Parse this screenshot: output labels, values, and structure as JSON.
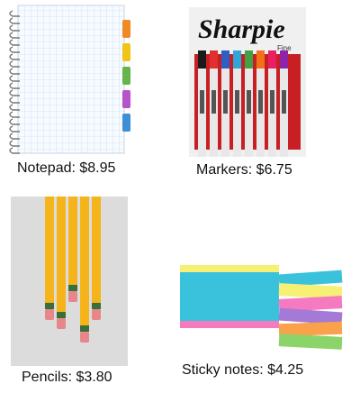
{
  "products": [
    {
      "name": "Notepad",
      "price": "$8.95",
      "caption": "Notepad: $8.95"
    },
    {
      "name": "Markers",
      "price": "$6.75",
      "caption": "Markers: $6.75",
      "brand_text": "Sharpie",
      "box_text": "Fine"
    },
    {
      "name": "Pencils",
      "price": "$3.80",
      "caption": "Pencils: $3.80"
    },
    {
      "name": "Sticky notes",
      "price": "$4.25",
      "caption": "Sticky notes: $4.25"
    }
  ],
  "colors": {
    "notepad_grid": "#b9d3ea",
    "notepad_tabs": [
      "#f08a24",
      "#f0c419",
      "#65b54a",
      "#b653c8",
      "#3f8fd6"
    ],
    "marker_colors": [
      "#1a1a1a",
      "#e0302f",
      "#2d5fc4",
      "#2ea7d8",
      "#43a047",
      "#f2711c",
      "#e91e63",
      "#8e24aa"
    ],
    "pencil_body": "#f4b41a",
    "sticky_colors": [
      "#3ac2dc",
      "#f6f075",
      "#f57ac0",
      "#a47ad6",
      "#f9a24b",
      "#8ad46a"
    ]
  }
}
